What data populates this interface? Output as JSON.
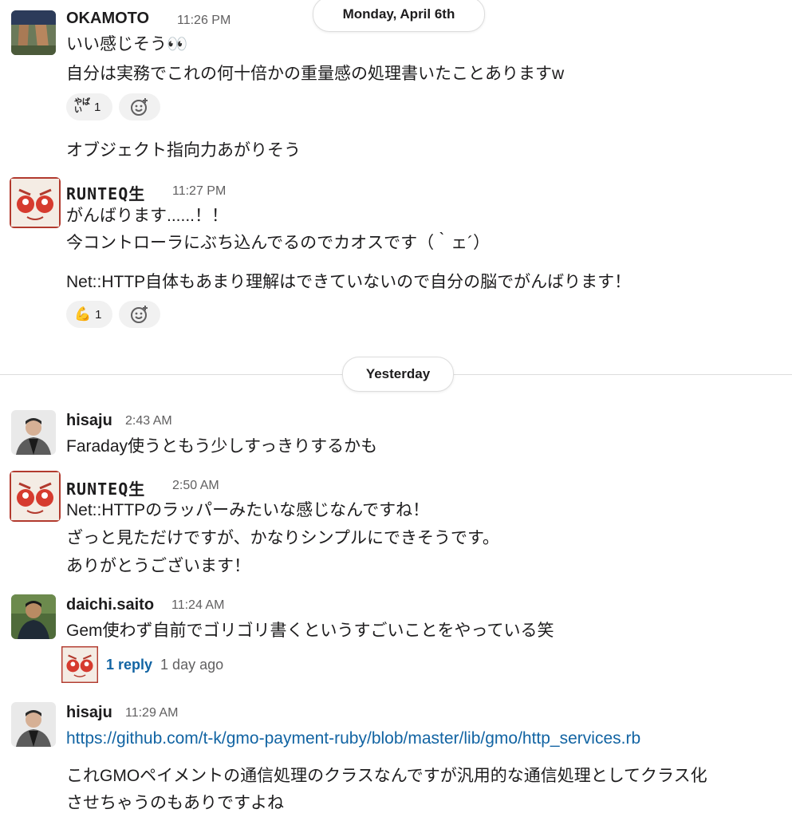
{
  "date_dividers": [
    "Monday, April 6th",
    "Yesterday"
  ],
  "messages": [
    {
      "author": "OKAMOTO",
      "time": "11:26 PM",
      "lines": [
        "いい感じそう👀",
        "自分は実務でこれの何十倍かの重量感の処理書いたことありますw"
      ],
      "reaction": {
        "emoji_text": "やばい",
        "count": "1"
      },
      "followup": [
        "オブジェクト指向力あがりそう"
      ]
    },
    {
      "author": "RUNTEQ生",
      "time": "11:27 PM",
      "lines": [
        "がんばります......！！",
        "今コントローラにぶち込んでるのでカオスです（｀ェ´）"
      ],
      "followup": [
        "Net::HTTP自体もあまり理解はできていないので自分の脳でがんばります！"
      ],
      "reaction": {
        "emoji": "💪",
        "count": "1"
      }
    },
    {
      "author": "hisaju",
      "time": "2:43 AM",
      "lines": [
        "Faraday使うともう少しすっきりするかも"
      ]
    },
    {
      "author": "RUNTEQ生",
      "time": "2:50 AM",
      "lines": [
        "Net::HTTPのラッパーみたいな感じなんですね！",
        "ざっと見ただけですが、かなりシンプルにできそうです。",
        "ありがとうございます！"
      ]
    },
    {
      "author": "daichi.saito",
      "time": "11:24 AM",
      "lines": [
        "Gem使わず自前でゴリゴリ書くというすごいことをやっている笑"
      ],
      "thread": {
        "replies": "1 reply",
        "last": "1 day ago"
      }
    },
    {
      "author": "hisaju",
      "time": "11:29 AM",
      "link": "https://github.com/t-k/gmo-payment-ruby/blob/master/lib/gmo/http_services.rb",
      "followup": [
        "これGMOペイメントの通信処理のクラスなんですが汎用的な通信処理としてクラス化",
        "させちゃうのもありですよね"
      ]
    }
  ],
  "icons": {
    "add_reaction": "add-reaction-icon",
    "runteq_avatar": "red-mascot-face",
    "photo_avatar": "person-photo"
  },
  "colors": {
    "link": "#1264a3",
    "muted": "#616061",
    "text": "#1d1c1d",
    "pill_bg": "#f1f1f1",
    "mascot_red": "#c0392b"
  }
}
